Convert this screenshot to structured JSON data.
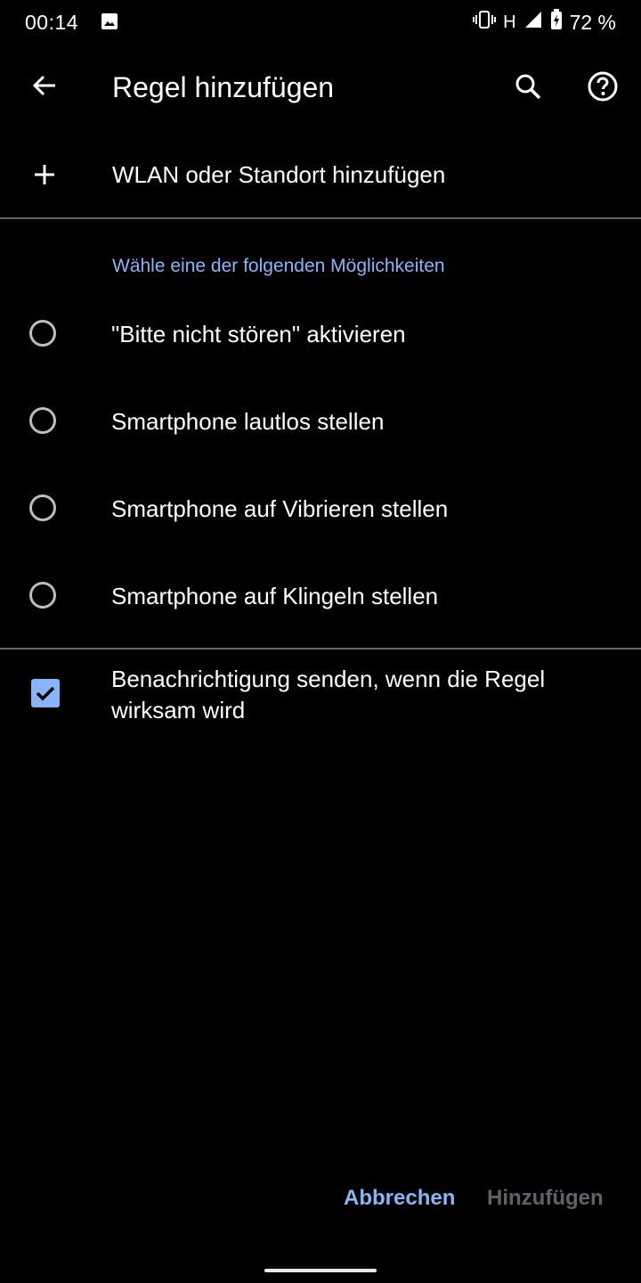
{
  "status_bar": {
    "time": "00:14",
    "network": "H",
    "battery": "72 %"
  },
  "app_bar": {
    "title": "Regel hinzufügen",
    "back_icon": "arrow-back-icon",
    "search_icon": "search-icon",
    "help_icon": "help-icon"
  },
  "add_trigger": {
    "label": "WLAN oder Standort hinzufügen",
    "icon": "plus-icon"
  },
  "options": {
    "section_title": "Wähle eine der folgenden Möglichkeiten",
    "items": [
      {
        "label": "\"Bitte nicht stören\" aktivieren",
        "selected": false
      },
      {
        "label": "Smartphone lautlos stellen",
        "selected": false
      },
      {
        "label": "Smartphone auf Vibrieren stellen",
        "selected": false
      },
      {
        "label": "Smartphone auf Klingeln stellen",
        "selected": false
      }
    ]
  },
  "notification": {
    "label": "Benachrichtigung senden, wenn die Regel wirksam wird",
    "checked": true
  },
  "actions": {
    "cancel_label": "Abbrechen",
    "add_label": "Hinzufügen",
    "add_enabled": false
  },
  "colors": {
    "accent": "#8ab4f8",
    "disabled": "#5f6368",
    "background": "#000000"
  }
}
